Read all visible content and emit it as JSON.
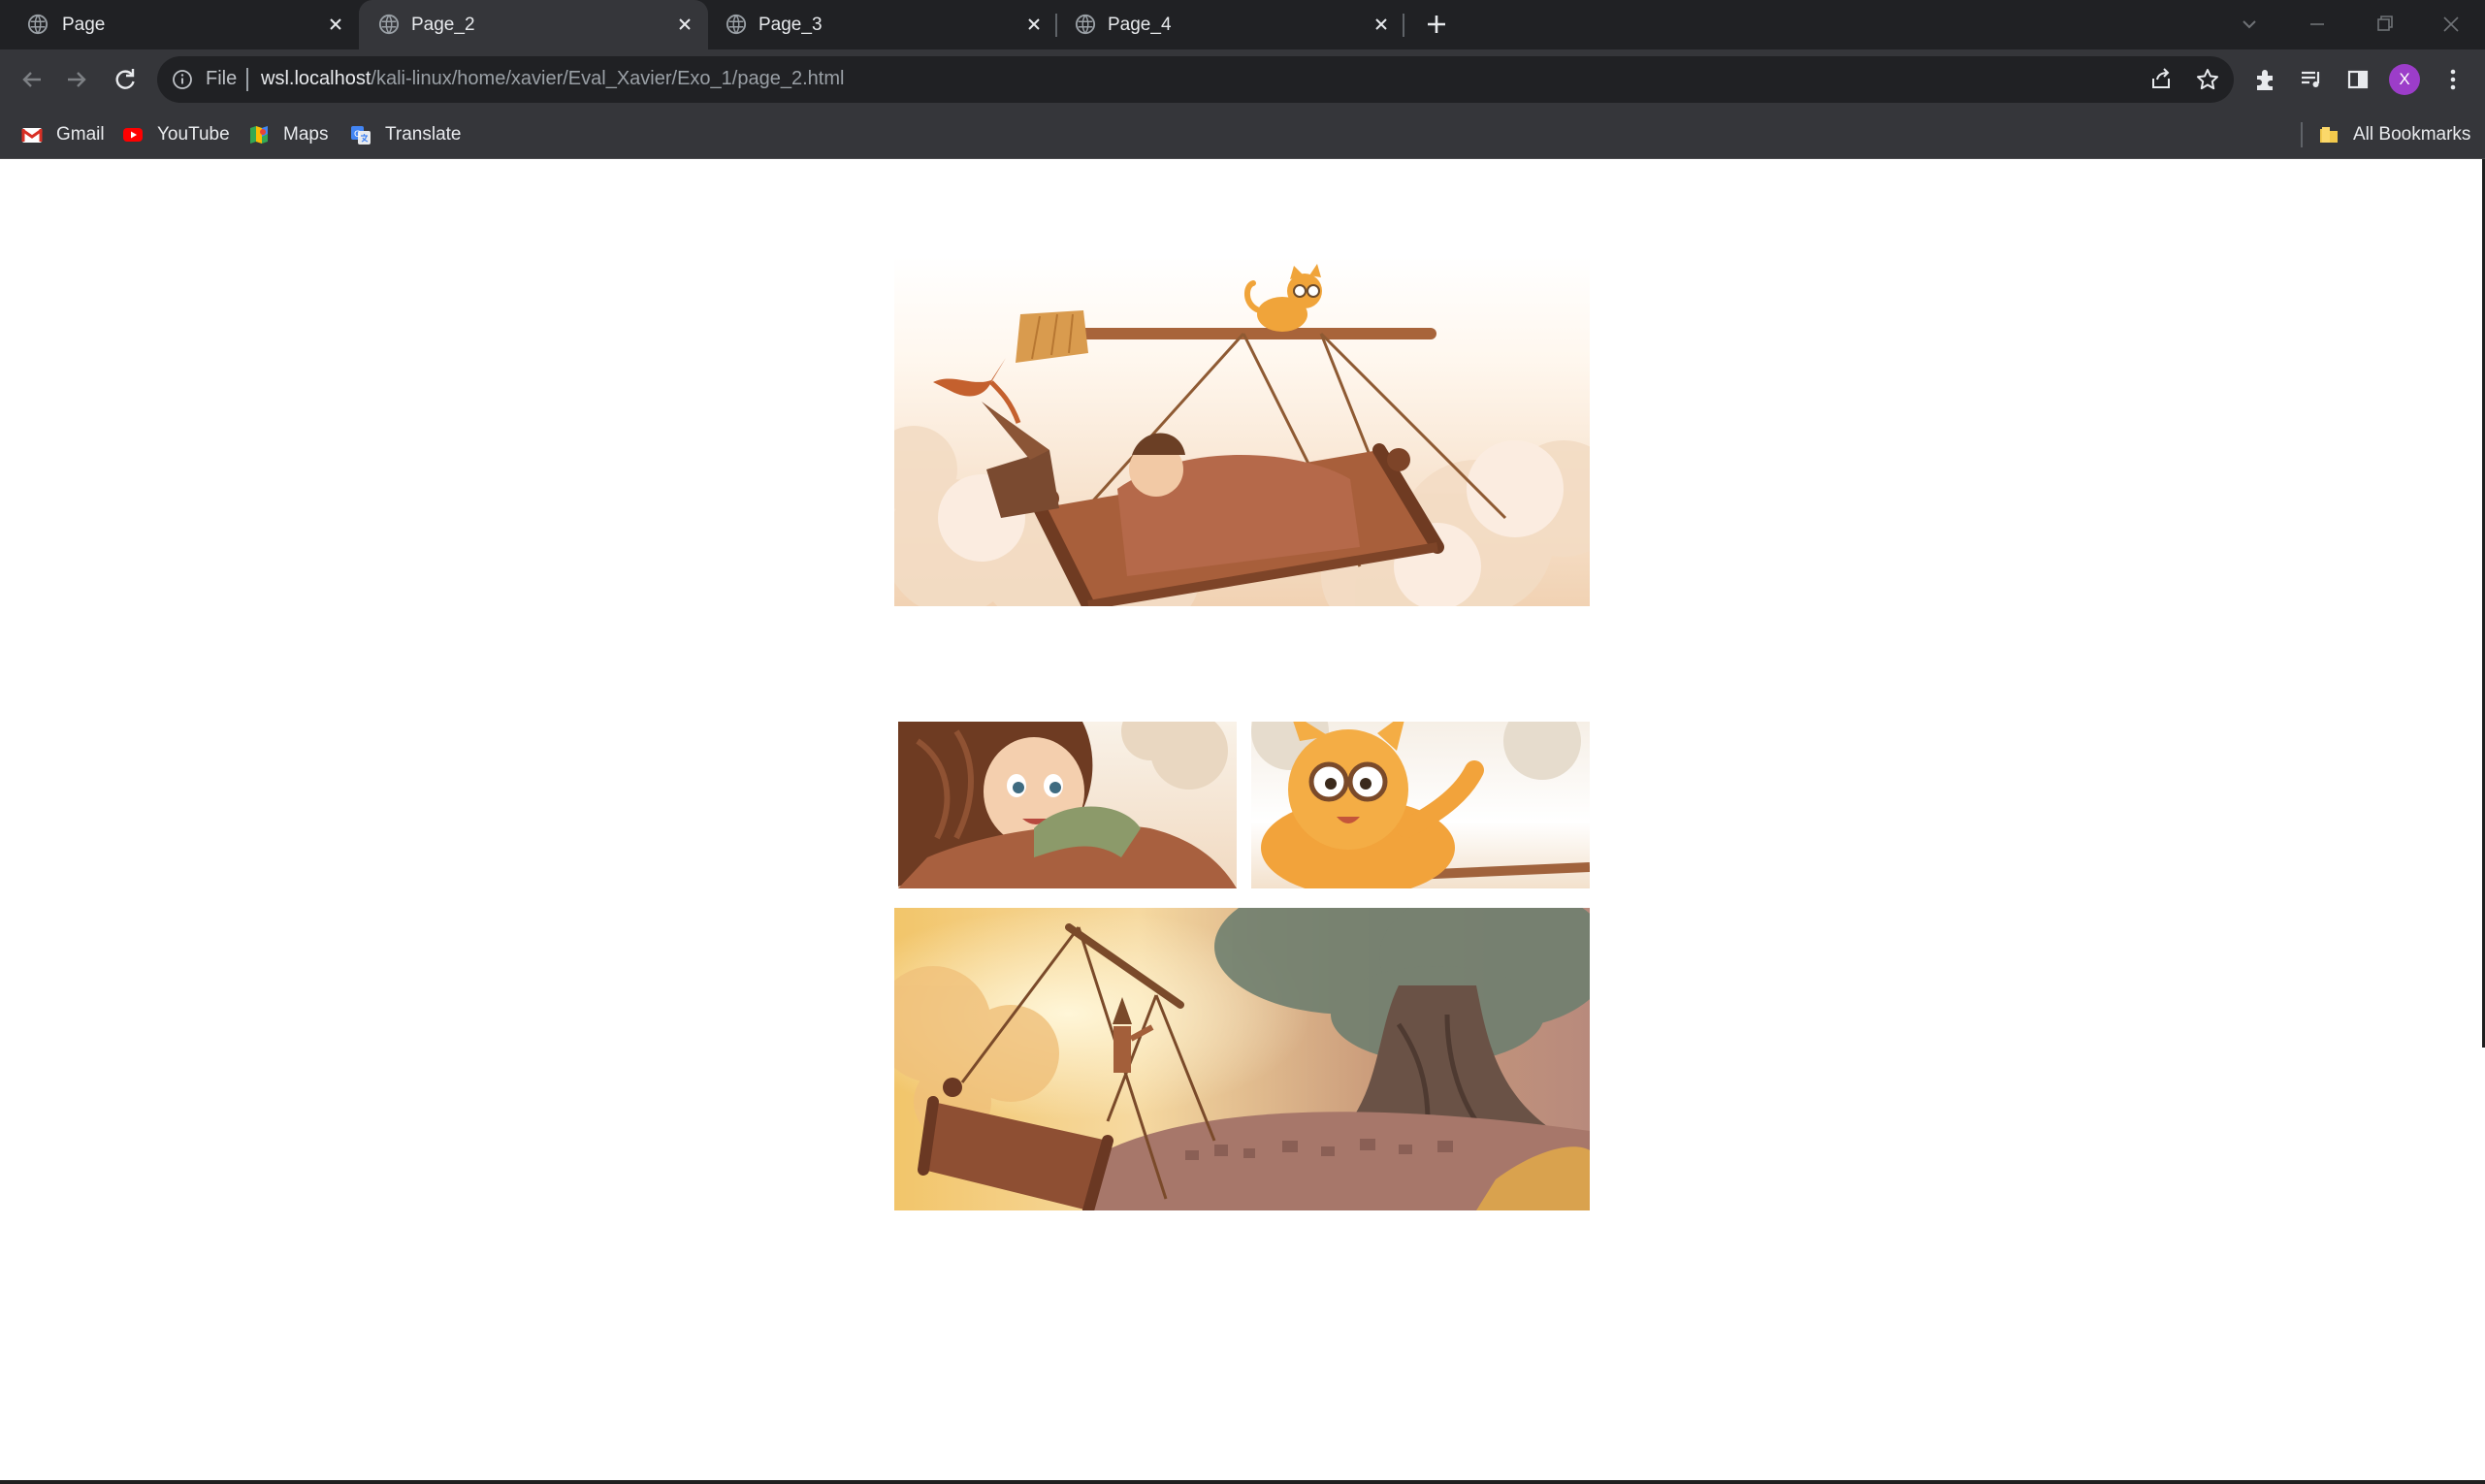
{
  "tabs": [
    {
      "title": "Page",
      "active": false
    },
    {
      "title": "Page_2",
      "active": true
    },
    {
      "title": "Page_3",
      "active": false
    },
    {
      "title": "Page_4",
      "active": false
    }
  ],
  "omnibox": {
    "scheme_label": "File",
    "host": "wsl.localhost",
    "path": "/kali-linux/home/xavier/Eval_Xavier/Exo_1/page_2.html"
  },
  "profile": {
    "initial": "X",
    "color": "#9c3dc9"
  },
  "bookmarks": [
    {
      "label": "Gmail",
      "icon": "gmail-icon"
    },
    {
      "label": "YouTube",
      "icon": "youtube-icon"
    },
    {
      "label": "Maps",
      "icon": "maps-icon"
    },
    {
      "label": "Translate",
      "icon": "translate-icon"
    }
  ],
  "all_bookmarks": {
    "label": "All Bookmarks",
    "icon": "folder-icon"
  },
  "page": {
    "panels": [
      {
        "name": "comic-panel-flying-bed",
        "subject": "flying bed carried by a broom with a cat and a small dragon above clouds"
      },
      {
        "name": "comic-panel-girl",
        "subject": "smiling girl with curly brown hair under a blanket"
      },
      {
        "name": "comic-panel-cat",
        "subject": "orange cat wearing goggles pointing ahead"
      },
      {
        "name": "comic-panel-sunset-tree",
        "subject": "flying bed at sunset approaching a giant tree above a town"
      }
    ]
  },
  "colors": {
    "tab_strip": "#202124",
    "toolbar": "#35363a",
    "omnibox": "#202124",
    "page_background": "#ffffff"
  }
}
